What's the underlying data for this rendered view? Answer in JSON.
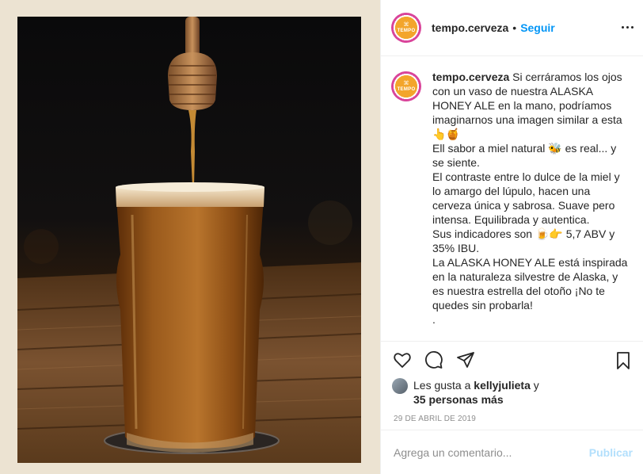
{
  "post": {
    "username": "tempo.cerveza",
    "separator": "•",
    "follow_label": "Seguir",
    "avatar_text": "TEMPO",
    "avatar_bow": "⌘"
  },
  "caption": {
    "username": "tempo.cerveza",
    "lines": [
      "Si cerráramos los ojos con un vaso de nuestra ALASKA HONEY ALE en la mano, podríamos imaginarnos una imagen similar a esta 👆🍯",
      "Ell sabor a miel natural 🐝 es real... y se siente.",
      "El contraste entre lo dulce de la miel y lo amargo del lúpulo, hacen una cerveza única y sabrosa. Suave pero intensa. Equilibrada y autentica.",
      "Sus indicadores son 🍺👉 5,7 ABV y 35% IBU.",
      "La ALASKA HONEY ALE está inspirada en la naturaleza silvestre de Alaska, y es nuestra estrella del otoño ¡No te quedes sin probarla!",
      "."
    ]
  },
  "actions": {
    "like_icon": "heart-icon",
    "comment_icon": "comment-icon",
    "share_icon": "paper-plane-icon",
    "save_icon": "bookmark-icon"
  },
  "likes": {
    "prefix": "Les gusta a",
    "user": "kellyjulieta",
    "connector": "y",
    "others": "35 personas más"
  },
  "date": "29 DE ABRIL DE 2019",
  "comment": {
    "placeholder": "Agrega un comentario...",
    "publish_label": "Publicar"
  },
  "colors": {
    "link_blue": "#0095f6",
    "publish_disabled": "#b2dffc",
    "brand_orange": "#f3a52b",
    "photo_frame": "#ece3d2"
  }
}
